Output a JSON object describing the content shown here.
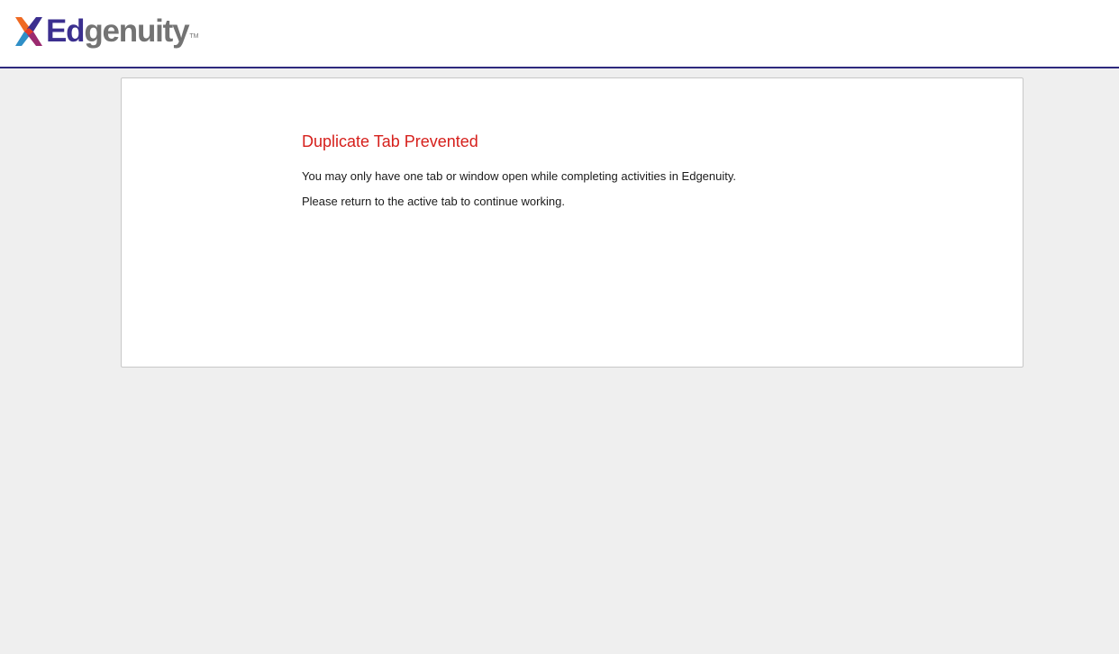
{
  "header": {
    "logo": {
      "icon": "edgenuity-x-mark-icon",
      "text_ed": "Ed",
      "text_rest": "genuity",
      "trademark": "TM",
      "colors": {
        "ed": "#3b2f8f",
        "genuity": "#737373"
      }
    },
    "border_color": "#2e2a7e"
  },
  "message": {
    "title": "Duplicate Tab Prevented",
    "line1": "You may only have one tab or window open while completing activities in Edgenuity.",
    "line2": "Please return to the active tab to continue working.",
    "title_color": "#d6201c"
  },
  "page": {
    "background": "#efefef"
  }
}
